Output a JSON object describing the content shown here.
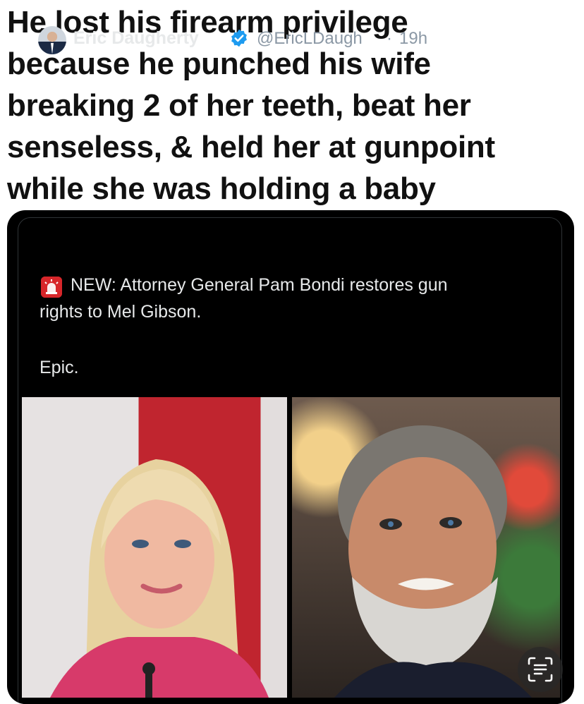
{
  "caption": {
    "lines": [
      "He lost his firearm privilege",
      "because he punched his wife",
      "breaking 2 of her teeth, beat her",
      "senseless, & held her at gunpoint",
      "while she was holding a baby"
    ]
  },
  "tweet": {
    "author_name": "Eric Daugherty",
    "handle": "@EricLDaugh",
    "separator": "·",
    "time": "19h",
    "body_line1": "NEW: Attorney General Pam Bondi restores gun",
    "body_line2": "rights to Mel Gibson.",
    "body_line3": "Epic.",
    "icons": [
      "avatar",
      "verified-icon",
      "siren-icon",
      "text-scan-icon"
    ]
  },
  "colors": {
    "page_bg": "#ffffff",
    "card_bg": "#000000",
    "verified_blue": "#1d9bf0",
    "tweet_text": "#e7e9ea",
    "meta_text": "#8b98a5"
  }
}
